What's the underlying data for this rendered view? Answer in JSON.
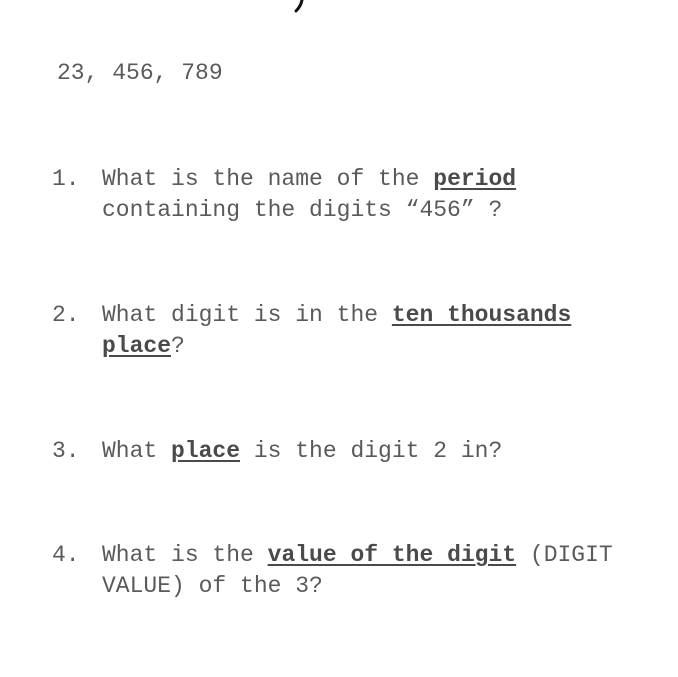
{
  "number": "23, 456, 789",
  "questions": [
    {
      "num": "1.",
      "pre": "What is the name of the ",
      "em": "period",
      "post": " containing the digits “456” ?"
    },
    {
      "num": "2.",
      "pre": "What digit is in the ",
      "em": "ten thousands place",
      "post": "?"
    },
    {
      "num": "3.",
      "pre": "What ",
      "em": "place",
      "post": " is the digit 2 in?"
    },
    {
      "num": "4.",
      "pre": "What is the ",
      "em": "value of the digit",
      "post": " (DIGIT VALUE) of the 3?"
    }
  ]
}
